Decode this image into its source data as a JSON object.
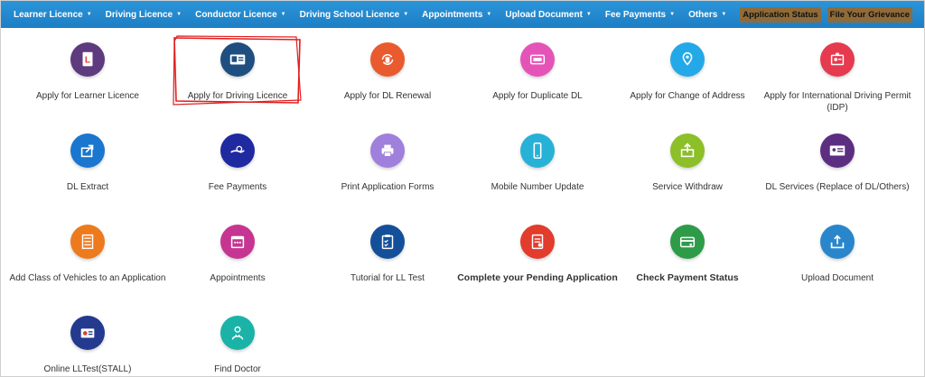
{
  "nav": {
    "items": [
      {
        "label": "Learner Licence"
      },
      {
        "label": "Driving Licence"
      },
      {
        "label": "Conductor Licence"
      },
      {
        "label": "Driving School Licence"
      },
      {
        "label": "Appointments"
      },
      {
        "label": "Upload Document"
      },
      {
        "label": "Fee Payments"
      },
      {
        "label": "Others"
      }
    ],
    "app_status_label": "Application Status",
    "grievance_label": "File Your Grievance"
  },
  "services": [
    {
      "label": "Apply for Learner Licence",
      "icon": "learner-licence-icon",
      "color": "#5e3a7e"
    },
    {
      "label": "Apply for Driving Licence",
      "icon": "driving-licence-card-icon",
      "color": "#1f4f80"
    },
    {
      "label": "Apply for DL Renewal",
      "icon": "renewal-icon",
      "color": "#ea5a2f"
    },
    {
      "label": "Apply for Duplicate DL",
      "icon": "duplicate-dl-icon",
      "color": "#e653b8"
    },
    {
      "label": "Apply for Change of Address",
      "icon": "location-pin-icon",
      "color": "#23a9e8"
    },
    {
      "label": "Apply for International Driving Permit (IDP)",
      "icon": "idp-badge-icon",
      "color": "#e63a4e"
    },
    {
      "label": "DL Extract",
      "icon": "share-icon",
      "color": "#1a76cf"
    },
    {
      "label": "Fee Payments",
      "icon": "hand-coin-icon",
      "color": "#1f2aa0"
    },
    {
      "label": "Print Application Forms",
      "icon": "printer-icon",
      "color": "#a080dd"
    },
    {
      "label": "Mobile Number Update",
      "icon": "mobile-phone-icon",
      "color": "#28b1d6"
    },
    {
      "label": "Service Withdraw",
      "icon": "withdraw-box-icon",
      "color": "#8cbf28"
    },
    {
      "label": "DL Services (Replace of DL/Others)",
      "icon": "id-card-icon",
      "color": "#5c2e82"
    },
    {
      "label": "Add Class of Vehicles to an Application",
      "icon": "document-list-icon",
      "color": "#ee7a1e"
    },
    {
      "label": "Appointments",
      "icon": "calendar-icon",
      "color": "#c63592"
    },
    {
      "label": "Tutorial for LL Test",
      "icon": "clipboard-icon",
      "color": "#14509a"
    },
    {
      "label": "Complete your Pending Application",
      "icon": "pending-form-icon",
      "color": "#e23c2c"
    },
    {
      "label": "Check Payment Status",
      "icon": "payment-card-icon",
      "color": "#2d9b48"
    },
    {
      "label": "Upload Document",
      "icon": "upload-icon",
      "color": "#2a86cc"
    },
    {
      "label": "Online LLTest(STALL)",
      "icon": "online-test-icon",
      "color": "#233a8e"
    },
    {
      "label": "Find Doctor",
      "icon": "doctor-icon",
      "color": "#1bb3a8"
    }
  ]
}
